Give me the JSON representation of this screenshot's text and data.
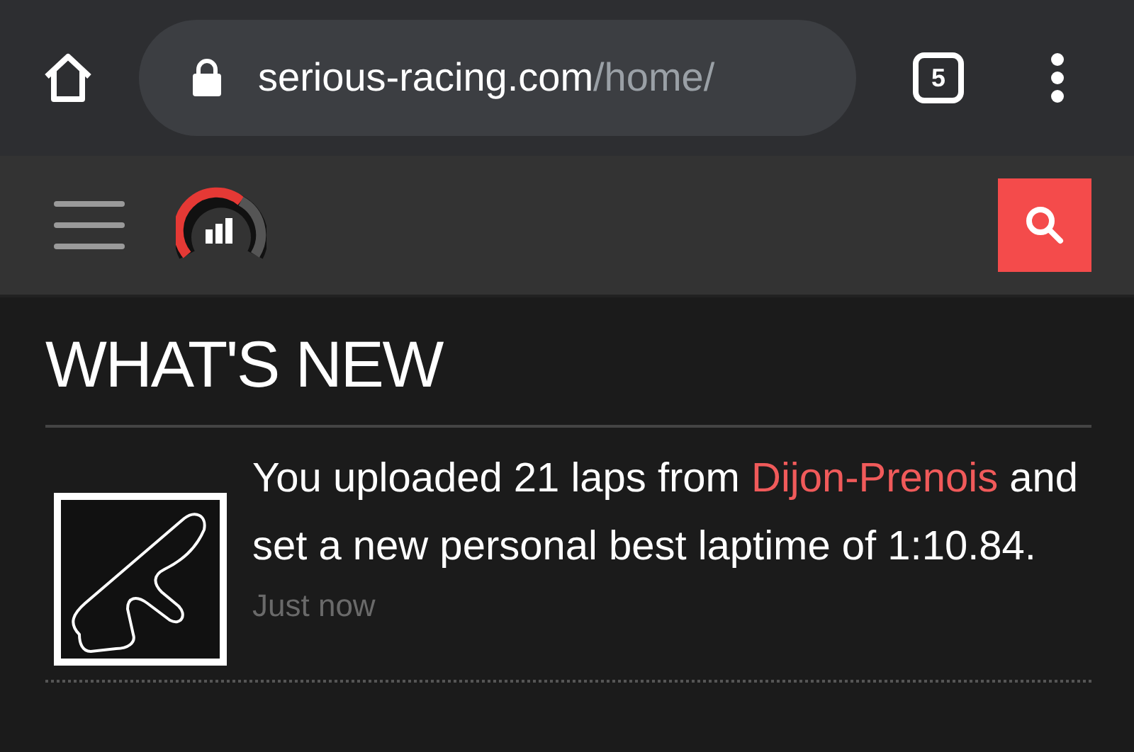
{
  "browser": {
    "url_host": "serious-racing.com",
    "url_path": "/home/",
    "tab_count": "5"
  },
  "section": {
    "title": "WHAT'S NEW"
  },
  "feed": [
    {
      "parts": [
        {
          "kind": "text",
          "text": "You uploaded 21 laps from "
        },
        {
          "kind": "link",
          "text": "Dijon-Prenois"
        },
        {
          "kind": "text",
          "text": " and set a new personal best laptime of 1:10.84."
        }
      ],
      "time": "Just now"
    }
  ]
}
